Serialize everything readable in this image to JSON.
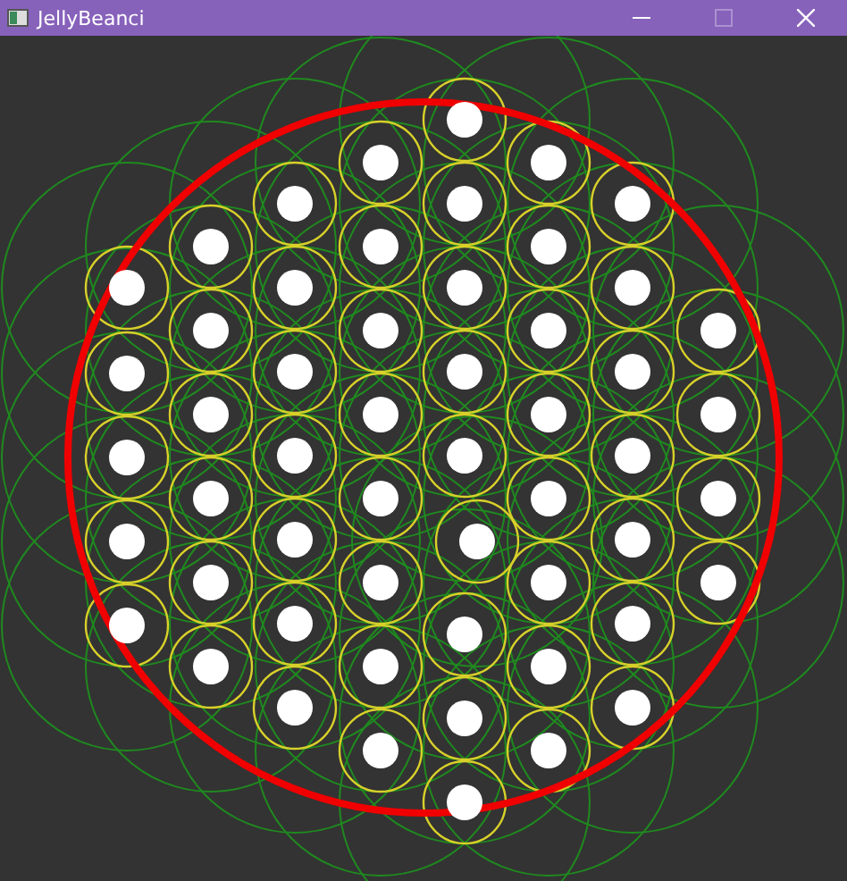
{
  "window": {
    "title": "JellyBeanci",
    "maximize_disabled": true
  }
}
